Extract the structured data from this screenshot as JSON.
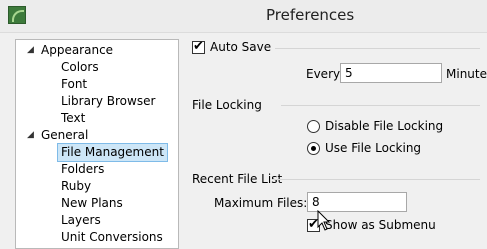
{
  "window": {
    "title": "Preferences"
  },
  "tree": {
    "items": [
      {
        "label": "Appearance",
        "expander": "◢",
        "indent": 0
      },
      {
        "label": "Colors",
        "indent": 1
      },
      {
        "label": "Font",
        "indent": 1
      },
      {
        "label": "Library Browser",
        "indent": 1
      },
      {
        "label": "Text",
        "indent": 1
      },
      {
        "label": "General",
        "expander": "◢",
        "indent": 0
      },
      {
        "label": "File Management",
        "indent": 1,
        "selected": true
      },
      {
        "label": "Folders",
        "indent": 1
      },
      {
        "label": "Ruby",
        "indent": 1
      },
      {
        "label": "New Plans",
        "indent": 1
      },
      {
        "label": "Layers",
        "indent": 1
      },
      {
        "label": "Unit Conversions",
        "indent": 1
      }
    ]
  },
  "auto_save": {
    "label": "Auto Save",
    "checked": true,
    "every_label": "Every",
    "value": "5",
    "unit": "Minutes"
  },
  "file_locking": {
    "heading": "File Locking",
    "options": [
      {
        "label": "Disable File Locking",
        "selected": false
      },
      {
        "label": "Use File Locking",
        "selected": true
      }
    ]
  },
  "recent_files": {
    "heading": "Recent File List",
    "max_label": "Maximum Files:",
    "max_value": "8",
    "submenu_label": "Show as Submenu",
    "submenu_checked": true
  },
  "icons": {
    "app": "app-logo-icon",
    "cursor": "mouse-pointer-icon"
  }
}
